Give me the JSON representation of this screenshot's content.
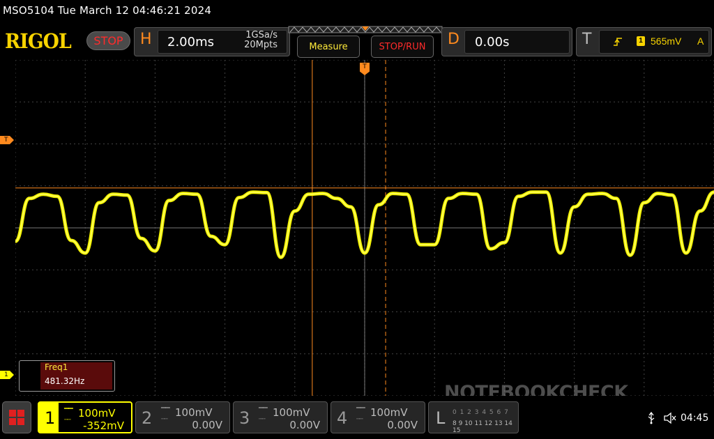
{
  "header": {
    "title": "MSO5104  Tue March 12 04:46:21 2024",
    "brand": "RIGOL",
    "run_state": "STOP"
  },
  "horizontal": {
    "letter": "H",
    "timebase": "2.00ms",
    "sample_rate": "1GSa/s",
    "memory_depth": "20Mpts"
  },
  "buttons": {
    "measure": "Measure",
    "stop_run": "STOP/RUN"
  },
  "delay": {
    "letter": "D",
    "value": "0.00s"
  },
  "trigger": {
    "letter": "T",
    "source": "1",
    "level": "565mV",
    "mode": "A",
    "edge_icon": "rising-edge-icon"
  },
  "markers": {
    "trigger_level": "T",
    "channel1": "1",
    "trigger_position": "T"
  },
  "measurement": {
    "label": "Freq1",
    "value": "481.32Hz"
  },
  "channels": [
    {
      "num": "1",
      "scale": "100mV",
      "offset": "-352mV",
      "coupling": "DC",
      "active": true,
      "color": "#ffff00"
    },
    {
      "num": "2",
      "scale": "100mV",
      "offset": "0.00V",
      "coupling": "DC",
      "active": false,
      "color": "#bdbdbd"
    },
    {
      "num": "3",
      "scale": "100mV",
      "offset": "0.00V",
      "coupling": "DC",
      "active": false,
      "color": "#bdbdbd"
    },
    {
      "num": "4",
      "scale": "100mV",
      "offset": "0.00V",
      "coupling": "DC",
      "active": false,
      "color": "#bdbdbd"
    }
  ],
  "logic": {
    "letter": "L",
    "row1": "0 1 2 3 4 5 6 7",
    "row2": "8 9 10 11 12 13 14 15"
  },
  "status": {
    "usb_icon": "usb-icon",
    "sound_icon": "speaker-muted-icon",
    "time": "04:45"
  },
  "watermark": "NOTEBOOKCHECK",
  "colors": {
    "trace": "#ffff00",
    "accent": "#ff8a1e",
    "stop": "#ff2b2b",
    "grid": "#555555"
  },
  "chart_data": {
    "type": "line",
    "title": "",
    "xlabel": "",
    "ylabel": "",
    "grid": true,
    "x_unit": "ms",
    "y_unit": "mV",
    "xlim": [
      -10,
      10
    ],
    "ylim": [
      -400,
      400
    ],
    "trigger_level_mV": 95,
    "cursor_time_ms": [
      -1.5,
      0.6
    ],
    "series": [
      {
        "x": [
          -10,
          -9.6,
          -9.2,
          -8.8,
          -8.4,
          -8.0,
          -7.6,
          -7.2,
          -6.8,
          -6.4,
          -6.0,
          -5.6,
          -5.2,
          -4.8,
          -4.4,
          -4.0,
          -3.6,
          -3.2,
          -2.8,
          -2.4,
          -2.0,
          -1.6,
          -1.2,
          -0.8,
          -0.4,
          0.0,
          0.4,
          0.8,
          1.2,
          1.6,
          2.0,
          2.4,
          2.8,
          3.2,
          3.6,
          4.0,
          4.4,
          4.8,
          5.2,
          5.6,
          6.0,
          6.4,
          6.8,
          7.2,
          7.6,
          8.0,
          8.4,
          8.8,
          9.2,
          9.6,
          10.0
        ],
        "y": [
          -32,
          70,
          80,
          75,
          -30,
          -60,
          60,
          80,
          78,
          -25,
          -55,
          65,
          82,
          80,
          -20,
          -40,
          72,
          85,
          84,
          -70,
          40,
          80,
          82,
          70,
          50,
          -60,
          55,
          82,
          80,
          -40,
          -40,
          70,
          82,
          80,
          -50,
          -35,
          75,
          85,
          85,
          -60,
          50,
          80,
          82,
          70,
          -65,
          60,
          82,
          78,
          -60,
          40,
          85
        ]
      }
    ]
  }
}
